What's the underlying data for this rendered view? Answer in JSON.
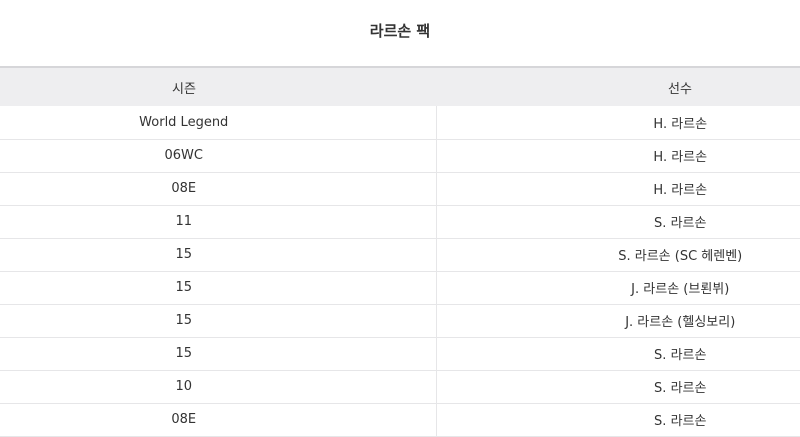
{
  "title": "라르손 팩",
  "table": {
    "headers": {
      "season": "시즌",
      "player": "선수"
    },
    "rows": [
      {
        "season": "World Legend",
        "player": "H. 라르손"
      },
      {
        "season": "06WC",
        "player": "H. 라르손"
      },
      {
        "season": "08E",
        "player": "H. 라르손"
      },
      {
        "season": "11",
        "player": "S. 라르손"
      },
      {
        "season": "15",
        "player": "S. 라르손 (SC 헤렌벤)"
      },
      {
        "season": "15",
        "player": "J. 라르손 (브뢴뷔)"
      },
      {
        "season": "15",
        "player": "J. 라르손 (헬싱보리)"
      },
      {
        "season": "15",
        "player": "S. 라르손"
      },
      {
        "season": "10",
        "player": "S. 라르손"
      },
      {
        "season": "08E",
        "player": "S. 라르손"
      }
    ]
  }
}
